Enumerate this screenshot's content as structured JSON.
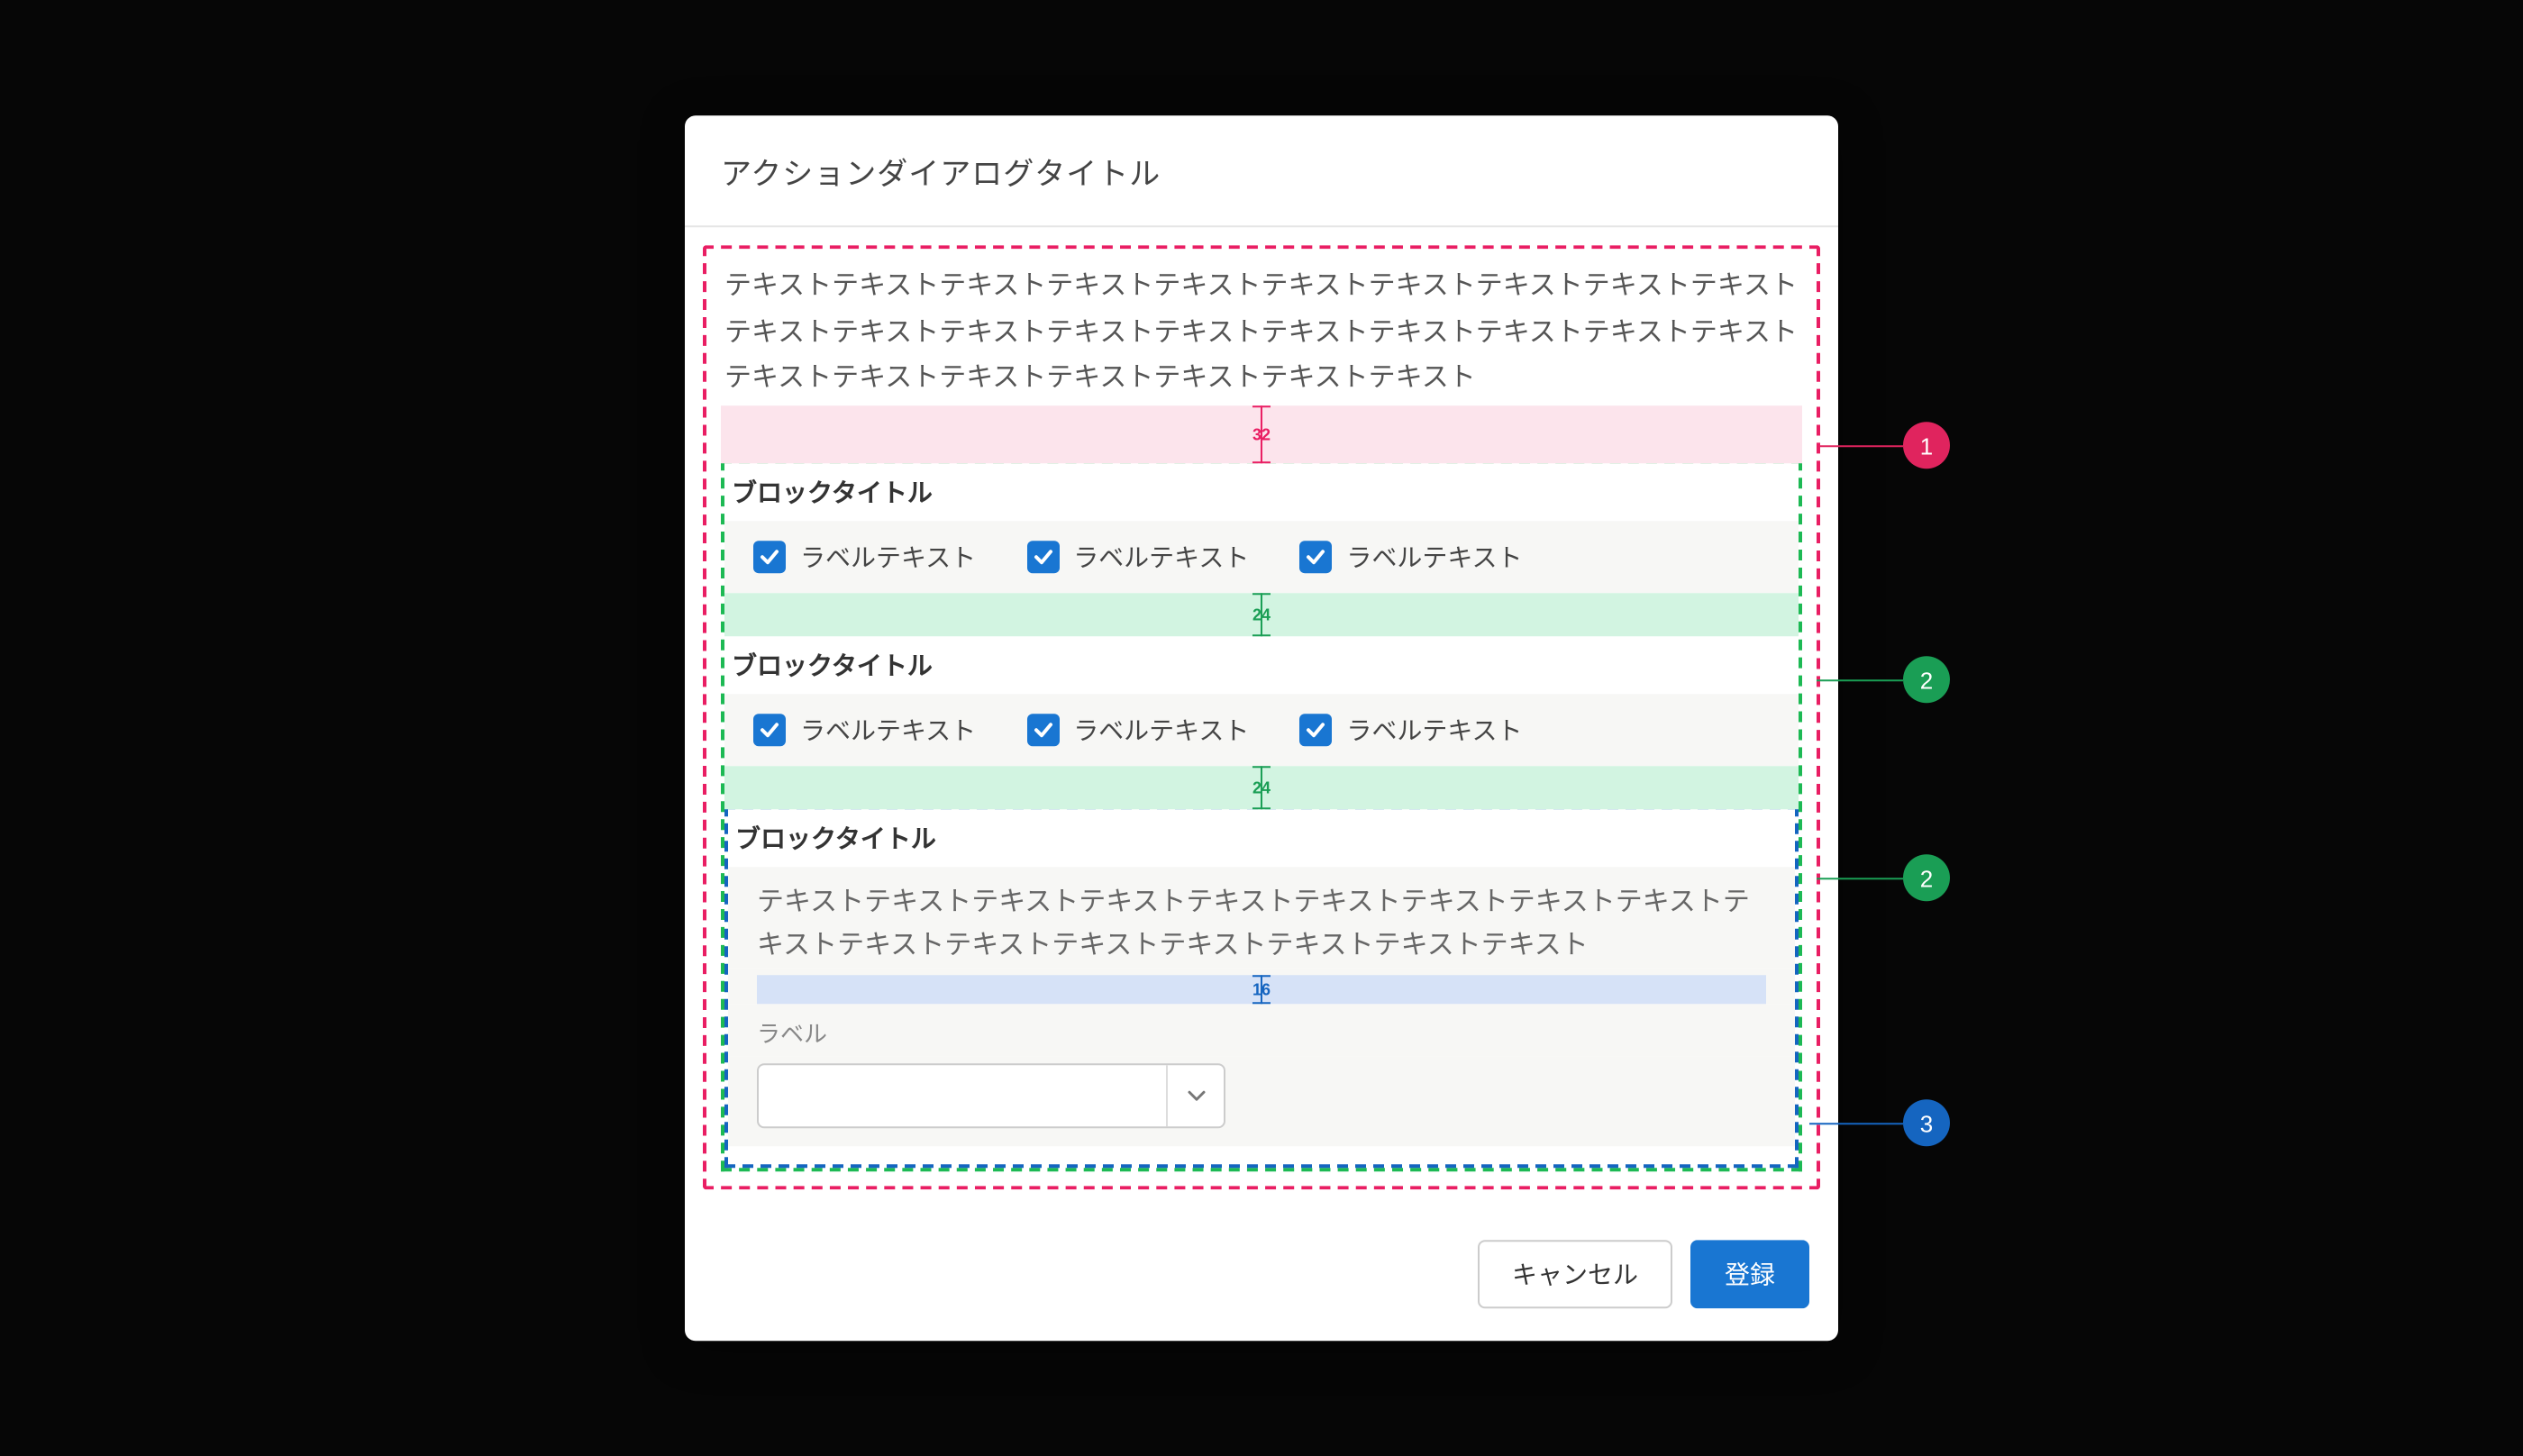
{
  "dialog": {
    "title": "アクションダイアログタイトル",
    "description": "テキストテキストテキストテキストテキストテキストテキストテキストテキストテキストテキストテキストテキストテキストテキストテキストテキストテキストテキストテキストテキストテキストテキストテキストテキストテキストテキスト"
  },
  "spacing": {
    "pink": "32",
    "green": "24",
    "blue": "16"
  },
  "blocks": [
    {
      "title": "ブロックタイトル",
      "checkboxes": [
        "ラベルテキスト",
        "ラベルテキスト",
        "ラベルテキスト"
      ]
    },
    {
      "title": "ブロックタイトル",
      "checkboxes": [
        "ラベルテキスト",
        "ラベルテキスト",
        "ラベルテキスト"
      ]
    },
    {
      "title": "ブロックタイトル",
      "body": "テキストテキストテキストテキストテキストテキストテキストテキストテキストテキストテキストテキストテキストテキストテキストテキストテキスト",
      "field_label": "ラベル",
      "select_value": ""
    }
  ],
  "buttons": {
    "cancel": "キャンセル",
    "submit": "登録"
  },
  "annotations": {
    "a1": "1",
    "a2": "2",
    "a3": "3"
  }
}
